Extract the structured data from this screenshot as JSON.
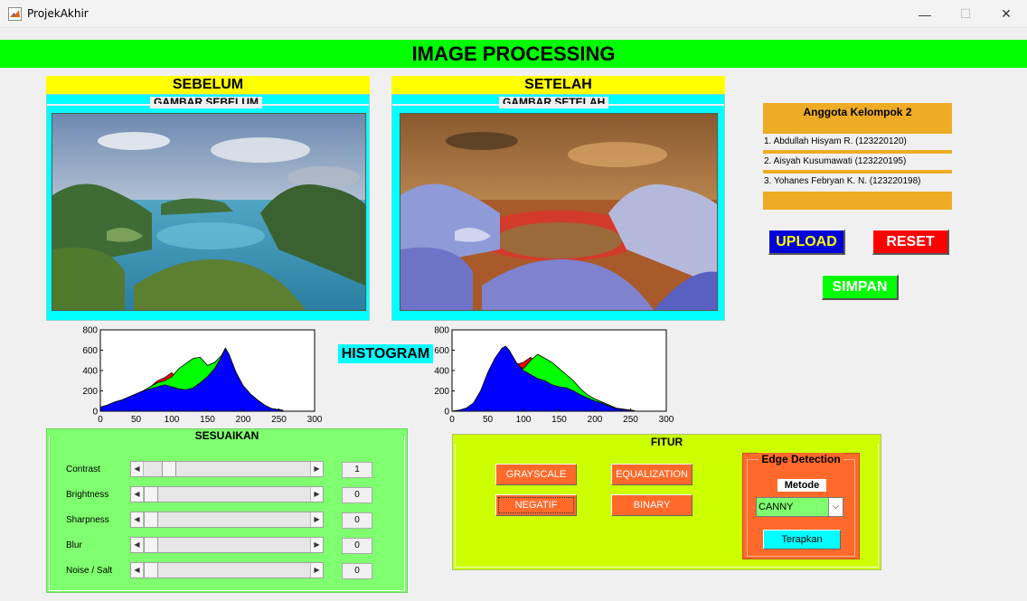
{
  "window": {
    "title": "ProjekAkhir",
    "minimize": "—",
    "maximize": "☐",
    "close": "✕"
  },
  "header": {
    "title": "IMAGE PROCESSING"
  },
  "before": {
    "heading": "SEBELUM",
    "panel_title": "GAMBAR SEBELUM"
  },
  "after": {
    "heading": "SETELAH",
    "panel_title": "GAMBAR SETELAH"
  },
  "histogram_label": "HISTOGRAM",
  "team": {
    "title": "Anggota Kelompok 2",
    "members": [
      "1. Abdullah Hisyam R. (123220120)",
      "2. Aisyah Kusumawati (123220195)",
      "3. Yohanes Febryan K. N. (123220198)"
    ]
  },
  "buttons": {
    "upload": "UPLOAD",
    "reset": "RESET",
    "save": "SIMPAN"
  },
  "adjust": {
    "title": "SESUAIKAN",
    "sliders": [
      {
        "label": "Contrast",
        "value": "1",
        "level": 0.12
      },
      {
        "label": "Brightness",
        "value": "0",
        "level": 0
      },
      {
        "label": "Sharpness",
        "value": "0",
        "level": 0
      },
      {
        "label": "Blur",
        "value": "0",
        "level": 0
      },
      {
        "label": "Noise / Salt",
        "value": "0",
        "level": 0
      }
    ]
  },
  "features": {
    "title": "FITUR",
    "grayscale": "GRAYSCALE",
    "equalization": "EQUALIZATION",
    "negative": "NEGATIF",
    "binary": "BINARY",
    "edge": {
      "title": "Edge Detection",
      "method_label": "Metode",
      "method_value": "CANNY",
      "apply": "Terapkan"
    }
  },
  "chart_data": [
    {
      "type": "area",
      "x_ticks": [
        "0",
        "50",
        "100",
        "150",
        "200",
        "250",
        "300"
      ],
      "y_ticks": [
        "0",
        "200",
        "400",
        "600",
        "800"
      ],
      "xlim": [
        0,
        300
      ],
      "ylim": [
        0,
        800
      ],
      "x": [
        0,
        10,
        20,
        30,
        40,
        50,
        60,
        70,
        80,
        90,
        100,
        110,
        120,
        130,
        140,
        150,
        160,
        170,
        175,
        180,
        190,
        200,
        210,
        220,
        230,
        240,
        250,
        255,
        256
      ],
      "series": [
        {
          "color": "#ff0000",
          "values": [
            40,
            60,
            90,
            110,
            140,
            170,
            200,
            240,
            300,
            330,
            380,
            290,
            240,
            250,
            320,
            380,
            450,
            550,
            620,
            560,
            380,
            250,
            170,
            110,
            60,
            25,
            15,
            10,
            0
          ]
        },
        {
          "color": "#00ff00",
          "values": [
            40,
            60,
            90,
            110,
            140,
            170,
            200,
            240,
            280,
            300,
            340,
            420,
            470,
            520,
            530,
            450,
            480,
            550,
            620,
            560,
            380,
            250,
            170,
            110,
            60,
            25,
            15,
            10,
            0
          ]
        },
        {
          "color": "#0000ff",
          "values": [
            40,
            60,
            90,
            110,
            140,
            170,
            200,
            220,
            240,
            260,
            240,
            220,
            210,
            230,
            280,
            340,
            420,
            540,
            620,
            560,
            380,
            250,
            170,
            110,
            60,
            25,
            15,
            10,
            0
          ]
        }
      ]
    },
    {
      "type": "area",
      "x_ticks": [
        "0",
        "50",
        "100",
        "150",
        "200",
        "250",
        "300"
      ],
      "y_ticks": [
        "0",
        "200",
        "400",
        "600",
        "800"
      ],
      "xlim": [
        0,
        300
      ],
      "ylim": [
        0,
        800
      ],
      "x": [
        0,
        10,
        20,
        30,
        40,
        50,
        60,
        70,
        75,
        80,
        90,
        100,
        110,
        120,
        130,
        140,
        150,
        160,
        170,
        180,
        190,
        200,
        210,
        220,
        230,
        240,
        250,
        255,
        256
      ],
      "series": [
        {
          "color": "#ff0000",
          "values": [
            0,
            10,
            30,
            60,
            120,
            250,
            400,
            560,
            600,
            520,
            460,
            480,
            530,
            470,
            400,
            330,
            260,
            230,
            240,
            200,
            150,
            120,
            90,
            60,
            30,
            20,
            10,
            5,
            0
          ]
        },
        {
          "color": "#00ff00",
          "values": [
            0,
            10,
            30,
            60,
            120,
            250,
            400,
            560,
            600,
            520,
            450,
            420,
            500,
            560,
            520,
            480,
            420,
            360,
            300,
            220,
            160,
            120,
            90,
            60,
            30,
            20,
            10,
            5,
            0
          ]
        },
        {
          "color": "#0000ff",
          "values": [
            0,
            10,
            30,
            80,
            200,
            380,
            520,
            620,
            640,
            600,
            480,
            400,
            360,
            320,
            300,
            260,
            240,
            230,
            200,
            160,
            130,
            100,
            80,
            50,
            25,
            15,
            8,
            4,
            0
          ]
        }
      ]
    }
  ]
}
